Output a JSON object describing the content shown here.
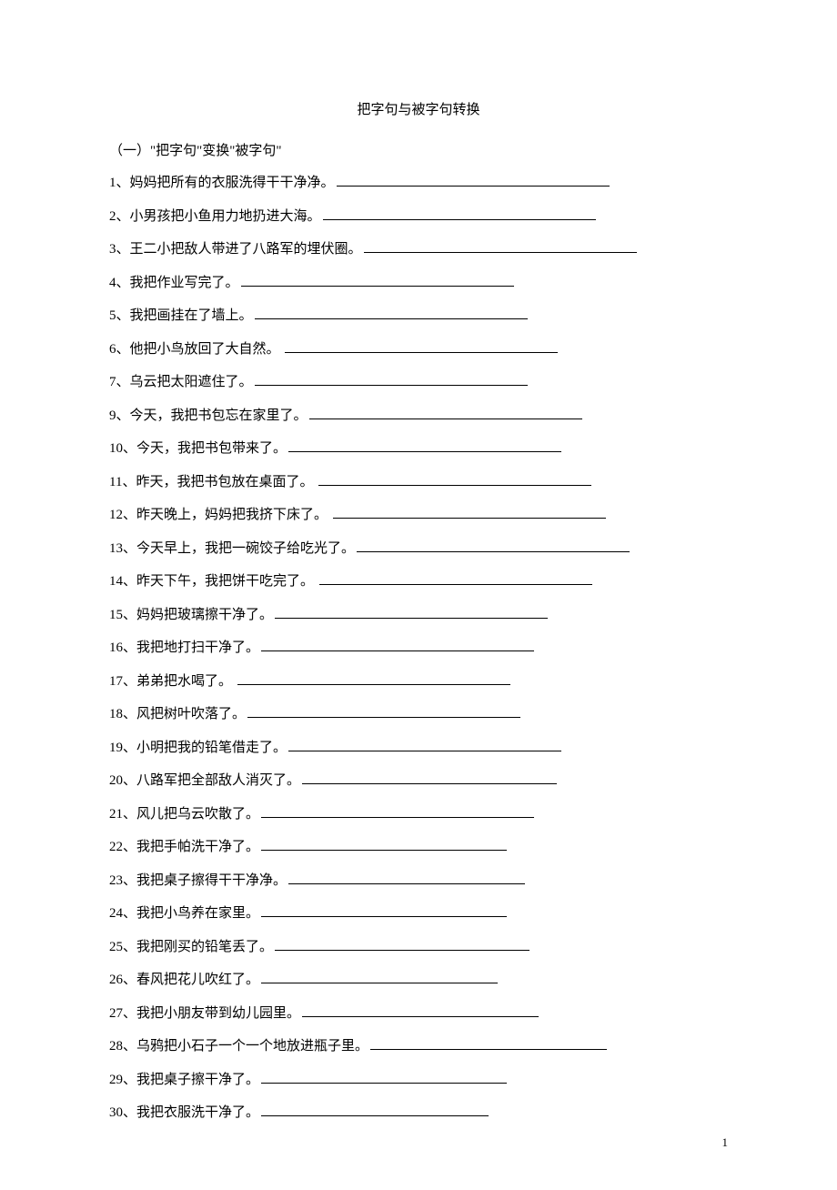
{
  "title": "把字句与被字句转换",
  "section_heading": "（一）\"把字句\"变换\"被字句\"",
  "items": [
    {
      "num": "1、",
      "text": "妈妈把所有的衣服洗得干干净净。",
      "blank": 300
    },
    {
      "num": "2、",
      "text": "小男孩把小鱼用力地扔进大海。",
      "blank": 300
    },
    {
      "num": "3、",
      "text": "王二小把敌人带进了八路军的埋伏圈。",
      "blank": 300
    },
    {
      "num": "4、",
      "text": "我把作业写完了。",
      "blank": 300
    },
    {
      "num": "5、",
      "text": "我把画挂在了墙上。",
      "blank": 300
    },
    {
      "num": "6、",
      "text": "他把小鸟放回了大自然。 ",
      "blank": 300
    },
    {
      "num": "7、",
      "text": "乌云把太阳遮住了。",
      "blank": 300
    },
    {
      "num": "9、",
      "text": "今天，我把书包忘在家里了。",
      "blank": 300
    },
    {
      "num": "10、",
      "text": "今天，我把书包带来了。",
      "blank": 300
    },
    {
      "num": "11、",
      "text": "昨天，我把书包放在桌面了。  ",
      "blank": 300
    },
    {
      "num": "12、",
      "text": "昨天晚上，妈妈把我挤下床了。  ",
      "blank": 300
    },
    {
      "num": "13、",
      "text": "今天早上，我把一碗饺子给吃光了。",
      "blank": 300
    },
    {
      "num": "14、",
      "text": "昨天下午，我把饼干吃完了。  ",
      "blank": 300
    },
    {
      "num": "15、",
      "text": "妈妈把玻璃擦干净了。",
      "blank": 300
    },
    {
      "num": "16、",
      "text": "我把地打扫干净了。",
      "blank": 300
    },
    {
      "num": "17、",
      "text": "弟弟把水喝了。  ",
      "blank": 300
    },
    {
      "num": "18、",
      "text": "风把树叶吹落了。",
      "blank": 300
    },
    {
      "num": "19、",
      "text": "小明把我的铅笔借走了。",
      "blank": 300
    },
    {
      "num": "20、",
      "text": "八路军把全部敌人消灭了。",
      "blank": 280
    },
    {
      "num": "21、",
      "text": "风儿把乌云吹散了。",
      "blank": 300
    },
    {
      "num": "22、",
      "text": "我把手帕洗干净了。",
      "blank": 270
    },
    {
      "num": "23、",
      "text": "我把桌子擦得干干净净。",
      "blank": 260
    },
    {
      "num": "24、",
      "text": "我把小鸟养在家里。",
      "blank": 270
    },
    {
      "num": "25、",
      "text": "我把刚买的铅笔丢了。",
      "blank": 280
    },
    {
      "num": "26、",
      "text": "春风把花儿吹红了。",
      "blank": 260
    },
    {
      "num": "27、",
      "text": "我把小朋友带到幼儿园里。",
      "blank": 260
    },
    {
      "num": "28、",
      "text": "乌鸦把小石子一个一个地放进瓶子里。",
      "blank": 260
    },
    {
      "num": "29、",
      "text": "我把桌子擦干净了。",
      "blank": 270
    },
    {
      "num": "30、",
      "text": "我把衣服洗干净了。",
      "blank": 250
    }
  ],
  "page_number": "1"
}
